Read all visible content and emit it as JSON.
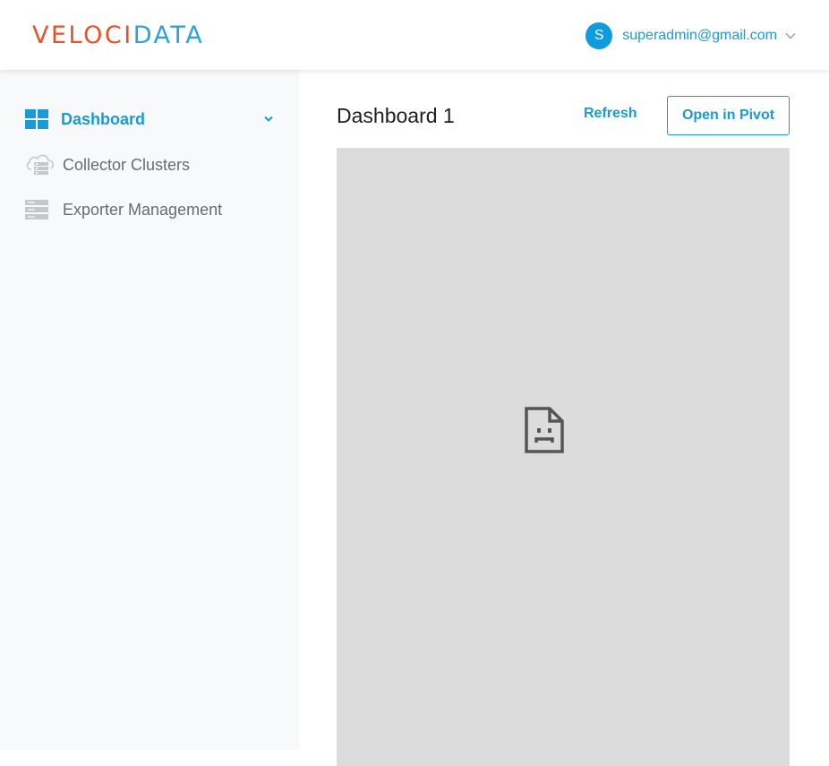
{
  "header": {
    "logo": {
      "part1": "VELOCI",
      "part2": "DATA"
    },
    "user": {
      "initial": "S",
      "email": "superadmin@gmail.com"
    }
  },
  "sidebar": {
    "items": [
      {
        "label": "Dashboard",
        "icon": "dashboard-grid-icon",
        "active": true
      },
      {
        "label": "Collector Clusters",
        "icon": "cloud-server-icon",
        "active": false
      },
      {
        "label": "Exporter Management",
        "icon": "server-stack-icon",
        "active": false
      }
    ]
  },
  "main": {
    "title": "Dashboard 1",
    "refresh_label": "Refresh",
    "pivot_label": "Open in Pivot",
    "frame_icon": "broken-document-icon"
  },
  "colors": {
    "brand_orange": "#e8522b",
    "brand_blue": "#2aa3d8",
    "accent": "#1a9ad6",
    "avatar": "#0f9be0",
    "sidebar_bg": "#f8f9fb",
    "frame_bg": "#dcdcdc"
  }
}
